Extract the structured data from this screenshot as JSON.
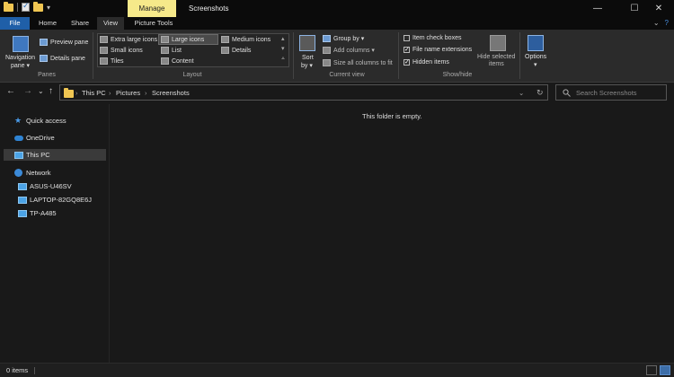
{
  "titlebar": {
    "manage_tab": "Manage",
    "title": "Screenshots",
    "minimize": "—",
    "maximize": "☐",
    "close": "✕"
  },
  "tabs": {
    "file": "File",
    "home": "Home",
    "share": "Share",
    "view": "View",
    "picture_tools": "Picture Tools",
    "collapse_ribbon": "⌄",
    "help": "?"
  },
  "ribbon": {
    "panes": {
      "label": "Panes",
      "navigation_pane_line1": "Navigation",
      "navigation_pane_line2": "pane ▾",
      "preview_pane": "Preview pane",
      "details_pane": "Details pane"
    },
    "layout": {
      "label": "Layout",
      "extra_large_icons": "Extra large icons",
      "large_icons": "Large icons",
      "medium_icons": "Medium icons",
      "small_icons": "Small icons",
      "list": "List",
      "details": "Details",
      "tiles": "Tiles",
      "content": "Content",
      "selected": "Large icons"
    },
    "current_view": {
      "label": "Current view",
      "sort_by_line1": "Sort",
      "sort_by_line2": "by ▾",
      "group_by": "Group by ▾",
      "add_columns": "Add columns ▾",
      "size_all_columns": "Size all columns to fit"
    },
    "show_hide": {
      "label": "Show/hide",
      "item_check_boxes": "Item check boxes",
      "file_name_extensions": "File name extensions",
      "hidden_items": "Hidden items",
      "hide_selected_line1": "Hide selected",
      "hide_selected_line2": "items"
    },
    "options": {
      "label_line1": "Options",
      "label_line2": "▾"
    }
  },
  "address": {
    "back": "←",
    "forward": "→",
    "recent": "⌄",
    "up": "↑",
    "crumbs": [
      "This PC",
      "Pictures",
      "Screenshots"
    ],
    "separator": "›",
    "dropdown": "⌄",
    "refresh": "↻",
    "search_placeholder": "Search Screenshots"
  },
  "nav_pane": {
    "quick_access": "Quick access",
    "onedrive": "OneDrive",
    "this_pc": "This PC",
    "network": "Network",
    "network_items": [
      "ASUS-U46SV",
      "LAPTOP-82GQ8E6J",
      "TP-A485"
    ]
  },
  "content": {
    "empty_message": "This folder is empty."
  },
  "status": {
    "items": "0 items"
  },
  "colors": {
    "accent": "#1f5fa8",
    "manage_tab": "#f6e98a",
    "folder": "#f0c652"
  }
}
